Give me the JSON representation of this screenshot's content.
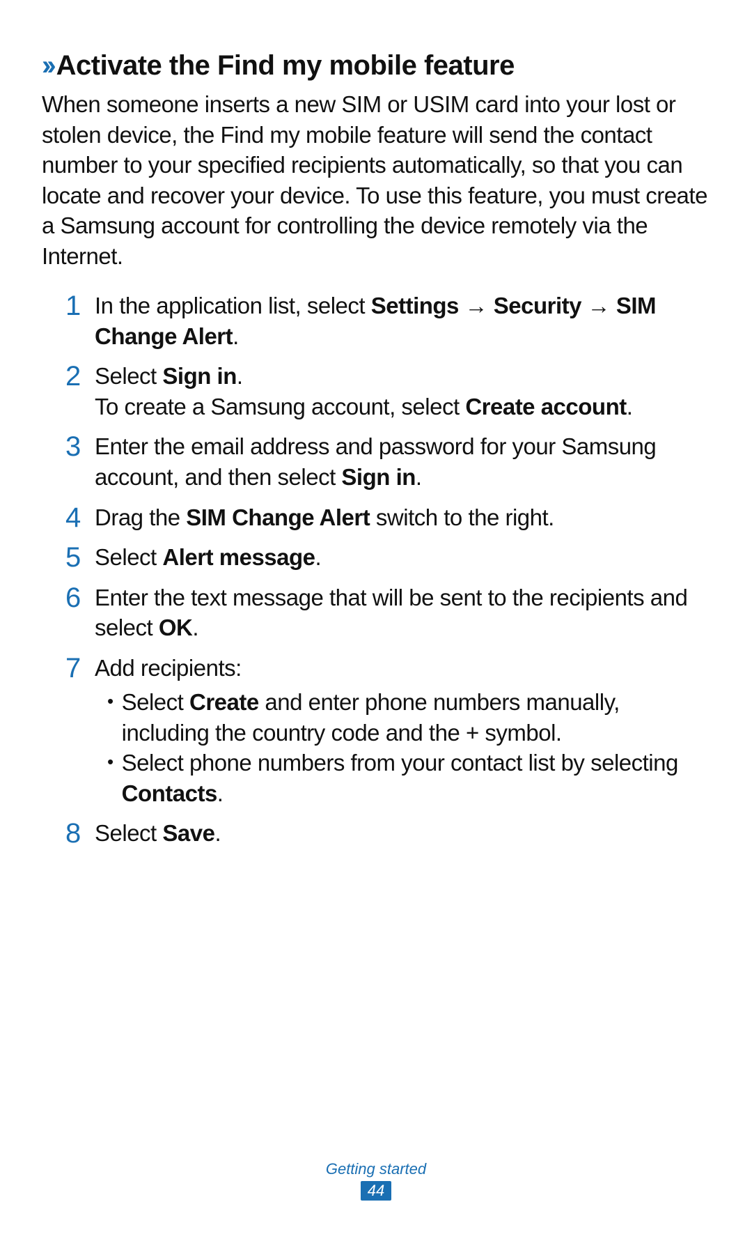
{
  "heading": {
    "chevrons": "››",
    "text": "Activate the Find my mobile feature"
  },
  "intro": "When someone inserts a new SIM or USIM card into your lost or stolen device, the Find my mobile feature will send the contact number to your specified recipients automatically, so that you can locate and recover your device. To use this feature, you must create a Samsung account for controlling the device remotely via the Internet.",
  "steps": {
    "s1": {
      "num": "1",
      "pre": "In the application list, select ",
      "b1": "Settings",
      "arr1": " → ",
      "b2": "Security",
      "arr2": " → ",
      "b3": "SIM Change Alert",
      "post": "."
    },
    "s2": {
      "num": "2",
      "pre": "Select ",
      "b1": "Sign in",
      "post": ".",
      "line2_pre": "To create a Samsung account, select ",
      "line2_b": "Create account",
      "line2_post": "."
    },
    "s3": {
      "num": "3",
      "pre": "Enter the email address and password for your Samsung account, and then select ",
      "b1": "Sign in",
      "post": "."
    },
    "s4": {
      "num": "4",
      "pre": "Drag the ",
      "b1": "SIM Change Alert",
      "post": " switch to the right."
    },
    "s5": {
      "num": "5",
      "pre": "Select ",
      "b1": "Alert message",
      "post": "."
    },
    "s6": {
      "num": "6",
      "pre": "Enter the text message that will be sent to the recipients and select ",
      "b1": "OK",
      "post": "."
    },
    "s7": {
      "num": "7",
      "intro": "Add recipients:",
      "bullet1_pre": "Select ",
      "bullet1_b": "Create",
      "bullet1_post": " and enter phone numbers manually, including the country code and the + symbol.",
      "bullet2_pre": "Select phone numbers from your contact list by selecting ",
      "bullet2_b": "Contacts",
      "bullet2_post": "."
    },
    "s8": {
      "num": "8",
      "pre": "Select ",
      "b1": "Save",
      "post": "."
    }
  },
  "footer": {
    "section": "Getting started",
    "page": "44"
  },
  "bullet_glyph": "•"
}
